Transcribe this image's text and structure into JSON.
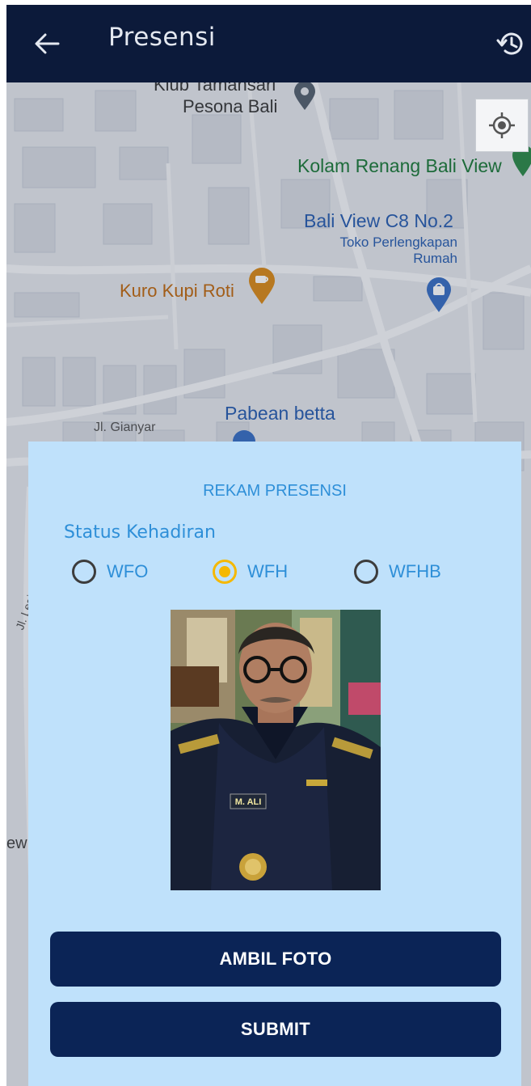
{
  "app_bar": {
    "title": "Presensi",
    "back_icon": "arrow-left-icon",
    "history_icon": "history-icon"
  },
  "map": {
    "locate_icon": "my-location-icon",
    "pois": {
      "klub": "Klub Tamansari",
      "pesona": "Pesona Bali",
      "kolam": "Kolam Renang Bali View",
      "baliview": "Bali View C8 No.2",
      "toko1": "Toko Perlengkapan",
      "toko2": "Rumah",
      "kuro": "Kuro Kupi Roti",
      "pabean": "Pabean betta",
      "gianyar": "Jl. Gianyar",
      "legian": "Jl. Legian",
      "edge": "ew"
    }
  },
  "card": {
    "title": "REKAM PRESENSI",
    "status_label": "Status Kehadiran",
    "options": [
      {
        "label": "WFO",
        "checked": false
      },
      {
        "label": "WFH",
        "checked": true
      },
      {
        "label": "WFHB",
        "checked": false
      }
    ],
    "photo_badge": "M. ALI",
    "ambil_label": "AMBIL FOTO",
    "submit_label": "SUBMIT"
  },
  "colors": {
    "app_bar": "#0c1a3a",
    "card": "#bfe1fb",
    "accent_text": "#2e8fd8",
    "radio_checked": "#f5b800",
    "button": "#0b2456"
  }
}
